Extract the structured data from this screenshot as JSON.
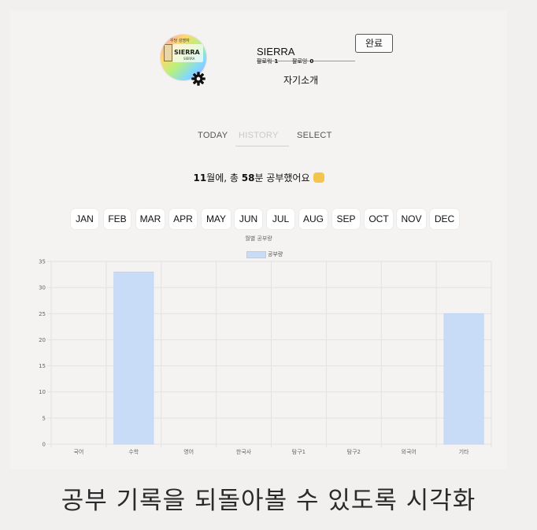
{
  "profile": {
    "avatar_top_text": "우당 성쟁자",
    "avatar_name_text": "SIERRA",
    "avatar_sub_text": "SIERRA",
    "username": "SIERRA",
    "done_label": "완료",
    "followers_label": "팔로워",
    "followers_count": "1",
    "following_label": "팔로잉",
    "following_count": "0",
    "intro": "자기소개"
  },
  "tabs": [
    {
      "label": "TODAY",
      "active": false
    },
    {
      "label": "HISTORY",
      "active": true
    },
    {
      "label": "SELECT",
      "active": false
    }
  ],
  "summary": {
    "month": "11",
    "part1": "월에, 총 ",
    "minutes": "58",
    "part2": "분 공부했어요",
    "emoji": "raising-hands-emoji"
  },
  "months": [
    "JAN",
    "FEB",
    "MAR",
    "APR",
    "MAY",
    "JUN",
    "JUL",
    "AUG",
    "SEP",
    "OCT",
    "NOV",
    "DEC"
  ],
  "caption": "공부 기록을 되돌아볼 수 있도록 시각화",
  "colors": {
    "bar": "#c9dcf7",
    "bar_border": "#b7cdf0",
    "background": "#f4f3f2"
  },
  "chart_data": {
    "type": "bar",
    "title": "월별 공부량",
    "categories": [
      "국어",
      "수학",
      "영어",
      "한국사",
      "탐구1",
      "탐구2",
      "외국어",
      "기타"
    ],
    "series": [
      {
        "name": "공부량",
        "values": [
          0,
          33,
          0,
          0,
          0,
          0,
          0,
          25
        ]
      }
    ],
    "ylim": [
      0,
      35
    ],
    "yticks": [
      0,
      5,
      10,
      15,
      20,
      25,
      30,
      35
    ],
    "grid": true,
    "legend": "top"
  }
}
